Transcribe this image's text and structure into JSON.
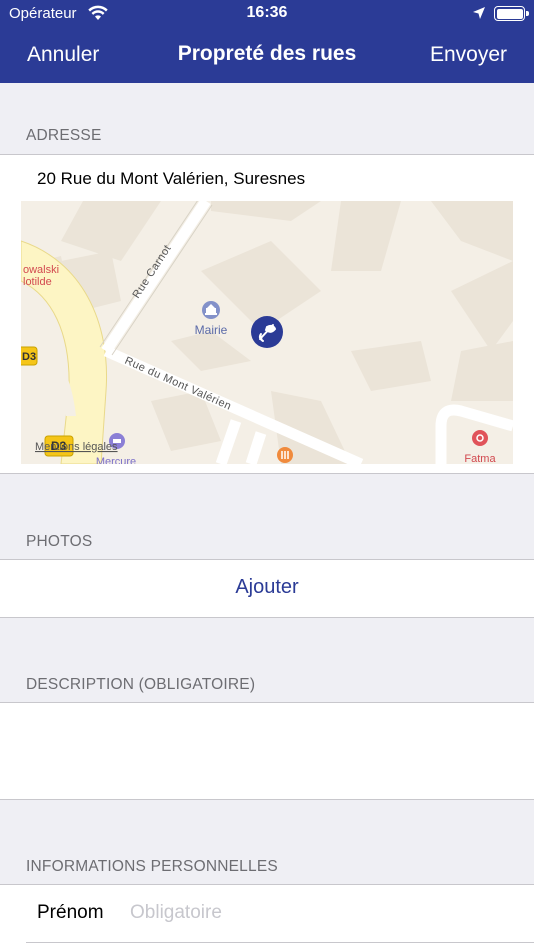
{
  "status_bar": {
    "carrier": "Opérateur",
    "time": "16:36"
  },
  "nav": {
    "cancel_label": "Annuler",
    "title": "Propreté des rues",
    "send_label": "Envoyer"
  },
  "address_section": {
    "header": "ADRESSE",
    "address": "20 Rue du Mont Valérien, Suresnes",
    "map": {
      "street_labels": [
        "Rue Carnot",
        "Rue du Mont Valérien"
      ],
      "poi_labels": [
        "Mairie",
        "Mercure",
        "Fatma"
      ],
      "partial_labels": [
        "owalski",
        "lotilde"
      ],
      "road_badges": [
        "D3",
        "D3"
      ],
      "legal_link": "Mentions légales"
    }
  },
  "photos_section": {
    "header": "PHOTOS",
    "add_label": "Ajouter"
  },
  "description_section": {
    "header": "DESCRIPTION (OBLIGATOIRE)",
    "value": ""
  },
  "personal_section": {
    "header": "INFORMATIONS PERSONNELLES",
    "first_name_label": "Prénom",
    "first_name_placeholder": "Obligatoire",
    "first_name_value": ""
  },
  "colors": {
    "brand": "#2b3b96",
    "background": "#efeff4",
    "header_text": "#6d6d72",
    "placeholder": "#c7c7cd",
    "map_road_badge": "#f5c518",
    "map_poi_red": "#e0535a",
    "map_poi_orange": "#f08a3c",
    "map_poi_purple": "#8b7fd6"
  },
  "icons": {
    "wifi": "wifi-icon",
    "location": "location-arrow-icon",
    "battery": "battery-icon",
    "map_pin": "cleanliness-pin-icon",
    "town_hall": "town-hall-icon",
    "restaurant": "restaurant-icon",
    "health": "health-icon",
    "hotel": "hotel-icon"
  }
}
